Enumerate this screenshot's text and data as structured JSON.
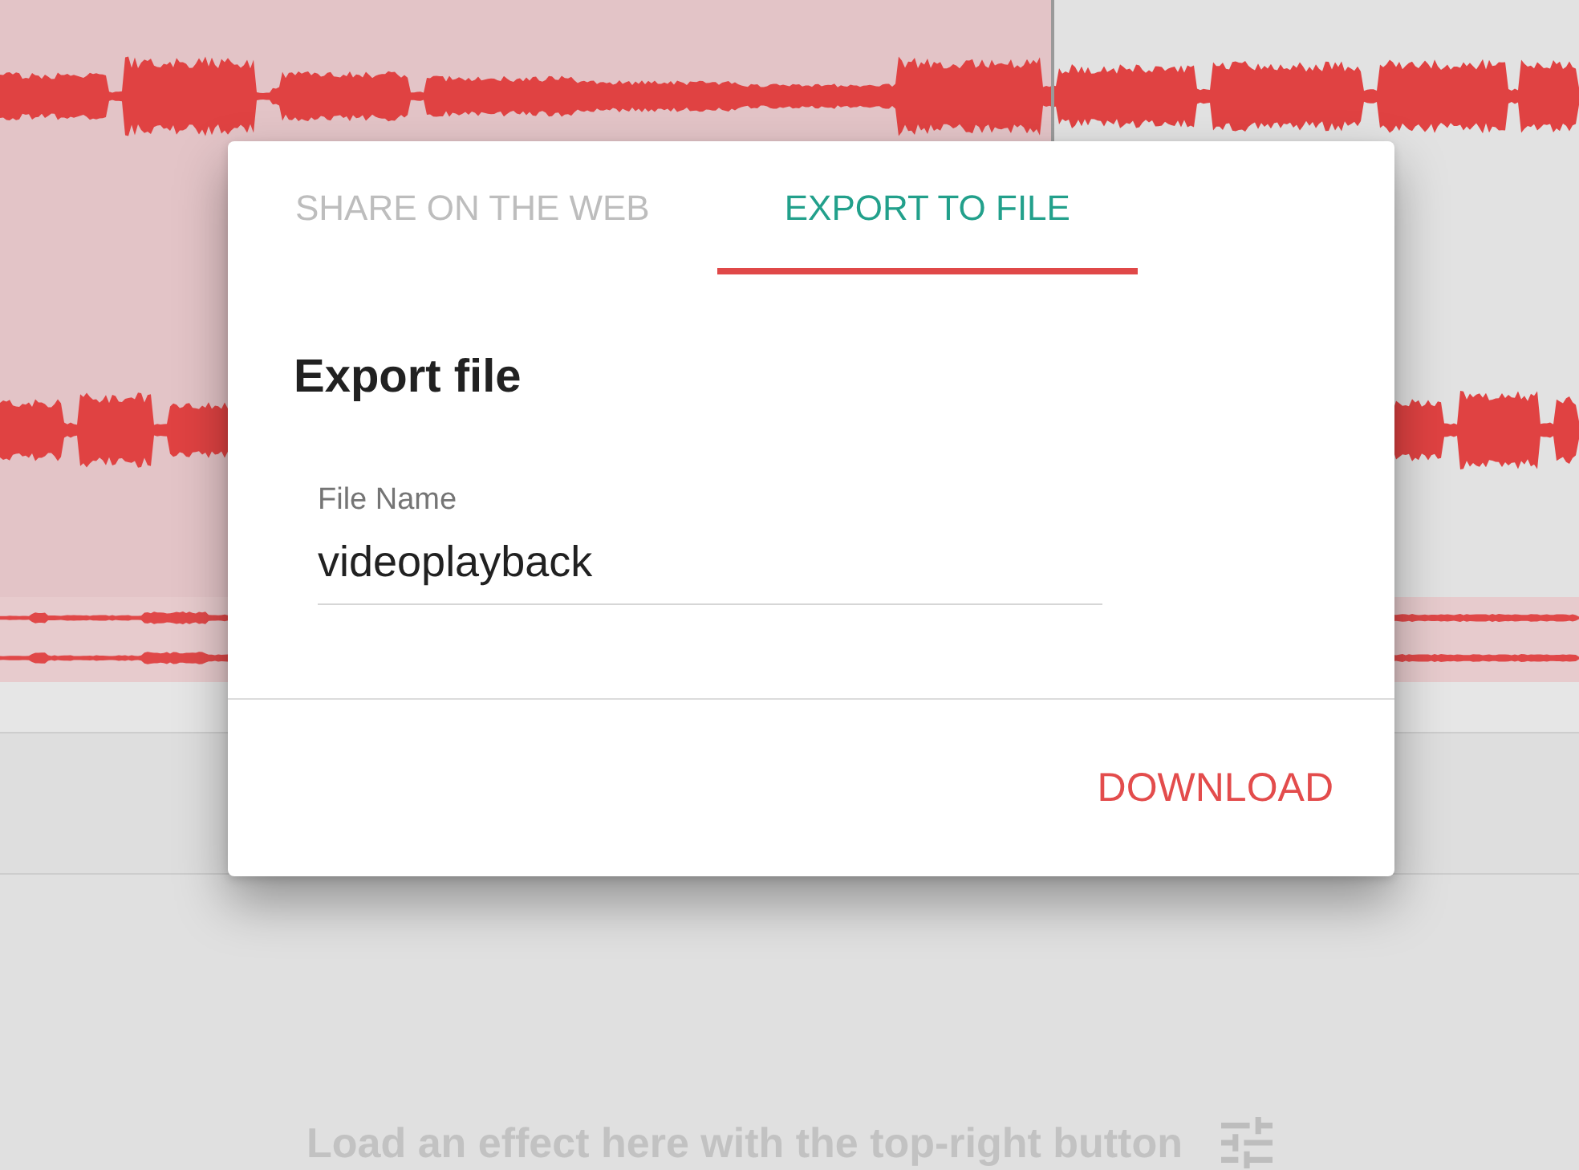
{
  "dialog": {
    "tabs": [
      {
        "label": "SHARE ON THE WEB",
        "selected": false
      },
      {
        "label": "EXPORT TO FILE",
        "selected": true
      }
    ],
    "title": "Export file",
    "field": {
      "label": "File Name",
      "value": "videoplayback"
    },
    "button": "DOWNLOAD"
  },
  "effects_panel": {
    "hint": "Load an effect here with the top-right button"
  }
}
